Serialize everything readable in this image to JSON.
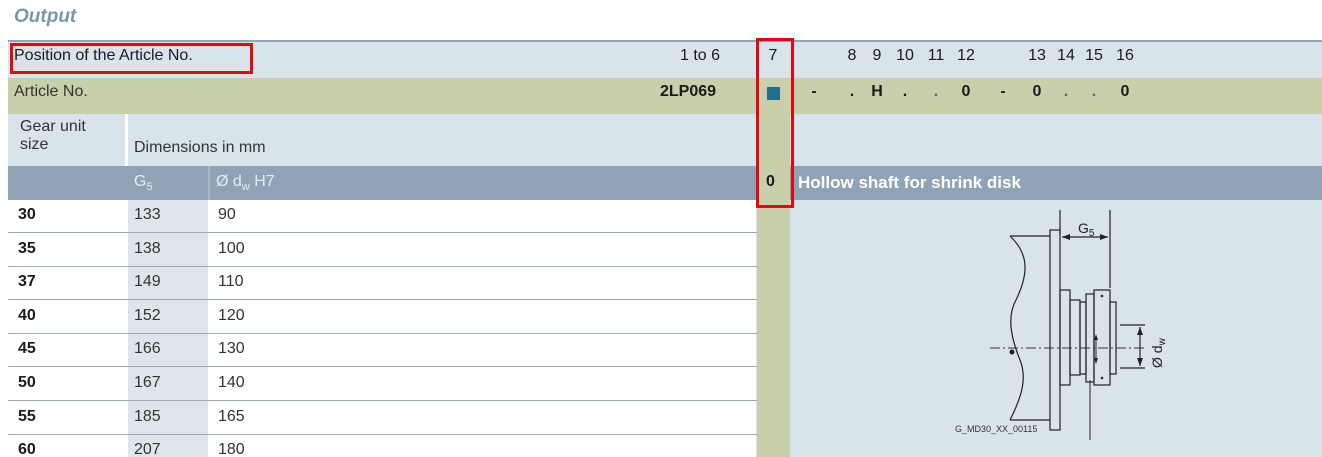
{
  "section_title": "Output",
  "position_row": {
    "label": "Position of the Article No.",
    "range": "1 to 6",
    "numbers": [
      "7",
      "8",
      "9",
      "10",
      "11",
      "12",
      "13",
      "14",
      "15",
      "16"
    ]
  },
  "article_row": {
    "label": "Article No.",
    "code": "2LP069",
    "symbols": [
      "-",
      ".",
      "H",
      ".",
      ".",
      "0",
      "-",
      "0",
      ".",
      ".",
      "0"
    ]
  },
  "table": {
    "gear_unit_label": "Gear unit size",
    "gear_unit_line1": "Gear unit",
    "gear_unit_line2": "size",
    "dimensions_label": "Dimensions in mm",
    "col_g5": "G",
    "col_g5_sub": "5",
    "col_dw": "Ø d",
    "col_dw_sub": "w",
    "col_dw_suffix": " H7",
    "rows": [
      {
        "size": "30",
        "g5": "133",
        "dw": "90"
      },
      {
        "size": "35",
        "g5": "138",
        "dw": "100"
      },
      {
        "size": "37",
        "g5": "149",
        "dw": "110"
      },
      {
        "size": "40",
        "g5": "152",
        "dw": "120"
      },
      {
        "size": "45",
        "g5": "166",
        "dw": "130"
      },
      {
        "size": "50",
        "g5": "167",
        "dw": "140"
      },
      {
        "size": "55",
        "g5": "185",
        "dw": "165"
      },
      {
        "size": "60",
        "g5": "207",
        "dw": "180"
      }
    ]
  },
  "option": {
    "code": "0",
    "description": "Hollow shaft for shrink disk"
  },
  "drawing": {
    "label_g5": "G",
    "label_g5_sub": "5",
    "label_dw": "Ø d",
    "label_dw_sub": "w",
    "caption": "G_MD30_XX_00115"
  },
  "colors": {
    "header_band": "#d9e3ea",
    "article_band": "#c8cfaa",
    "subheader": "#8ea3b5",
    "highlight": "#e30613",
    "title": "#7a96ad"
  }
}
